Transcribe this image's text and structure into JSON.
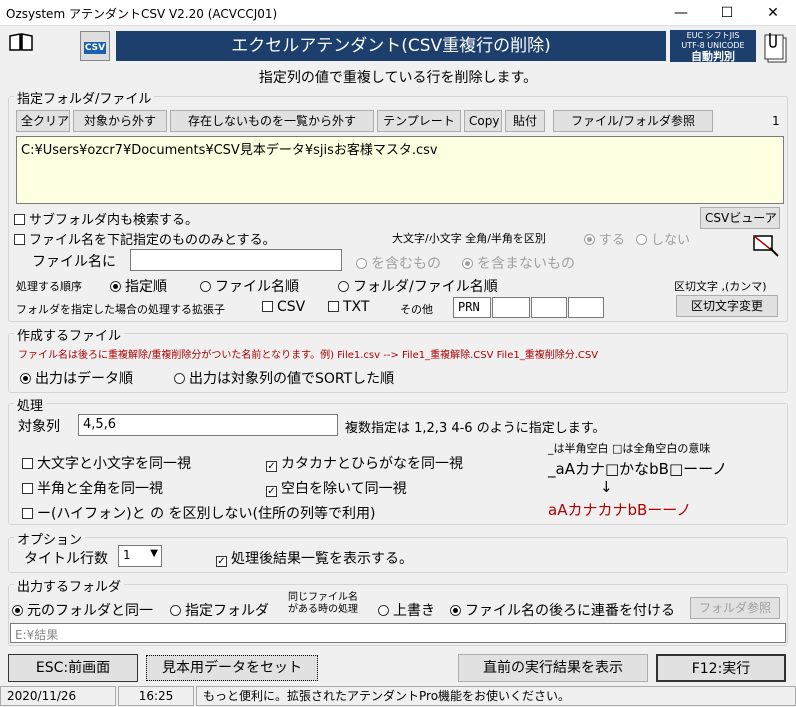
{
  "window": {
    "title": "Ozsystem アテンダントCSV V2.20 (ACVCCJ01)",
    "min": "—",
    "max": "☐",
    "close": "✕"
  },
  "header": {
    "banner": "エクセルアテンダント(CSV重複行の削除)",
    "csv_logo": "CSV",
    "encoding_line1": "EUC  シフトJIS",
    "encoding_line2": "UTF-8 UNICODE",
    "encoding_line3": "自動判別",
    "subtitle": "指定列の値で重複している行を削除します。"
  },
  "folder_group": {
    "label": "指定フォルダ/ファイル",
    "buttons": [
      "全クリア",
      "対象から外す",
      "存在しないものを一覧から外す",
      "テンプレート",
      "Copy",
      "貼付",
      "ファイル/フォルダ参照"
    ],
    "count": "1",
    "file_list": [
      "C:¥Users¥ozcr7¥Documents¥CSV見本データ¥sjisお客様マスタ.csv"
    ],
    "subfolder_search": "サブフォルダ内も検索する。",
    "filename_filter": "ファイル名を下記指定のもののみとする。",
    "csv_viewer": "CSVビューア",
    "case_label": "大文字/小文字 全角/半角を区別",
    "case_yes": "する",
    "case_no": "しない",
    "filename_label": "ファイル名に",
    "filename_value": "",
    "contains": "を含むもの",
    "not_contains": "を含まないもの",
    "order_label": "処理する順序",
    "order_opts": [
      "指定順",
      "ファイル名順",
      "フォルダ/ファイル名順"
    ],
    "delim_label": "区切文字 ,(カンマ)",
    "ext_label": "フォルダを指定した場合の処理する拡張子",
    "ext_csv": "CSV",
    "ext_txt": "TXT",
    "ext_other": "その他",
    "ext_values": [
      "PRN",
      "",
      "",
      ""
    ],
    "delim_change": "区切文字変更"
  },
  "output_file": {
    "label": "作成するファイル",
    "note": "ファイル名は後ろに重複解除/重複削除分がついた名前となります。例) File1.csv  -->  File1_重複解除.CSV  File1_重複削除分.CSV",
    "opt_data_order": "出力はデータ順",
    "opt_sorted": "出力は対象列の値でSORTした順"
  },
  "process": {
    "label": "処理",
    "target_label": "対象列",
    "target_value": "4,5,6",
    "target_hint": "複数指定は  1,2,3   4-6 のように指定します。",
    "case_same": "大文字と小文字を同一視",
    "width_same": "半角と全角を同一視",
    "hyphen": "ー(ハイフォン)と の を区別しない(住所の列等で利用)",
    "kana_same": "カタカナとひらがなを同一視",
    "space_same": "空白を除いて同一視",
    "legend_note": "_は半角空白 □は全角空白の意味",
    "example_before": "_aAカナ□かなbB□ーーノ",
    "arrow": "↓",
    "example_after": "aAカナカナbBーーノ"
  },
  "options": {
    "label": "オプション",
    "title_rows_label": "タイトル行数",
    "title_rows_value": "1",
    "show_result": "処理後結果一覧を表示する。"
  },
  "output_folder": {
    "label": "出力するフォルダ",
    "same_folder": "元のフォルダと同一",
    "specified_folder": "指定フォルダ",
    "same_name_l1": "同じファイル名",
    "same_name_l2": "がある時の処理",
    "overwrite": "上書き",
    "add_seq": "ファイル名の後ろに連番を付ける",
    "browse": "フォルダ参照",
    "path": "E:¥結果"
  },
  "actions": {
    "esc": "ESC:前画面",
    "sample": "見本用データをセット",
    "last_result": "直前の実行結果を表示",
    "run": "F12:実行"
  },
  "statusbar": {
    "date": "2020/11/26",
    "time": "16:25",
    "message": "もっと便利に。拡張されたアテンダントPro機能をお使いください。"
  },
  "colors": {
    "banner_bg": "#1c3f6e",
    "list_bg": "#ffffe1",
    "red_text": "#b00000"
  }
}
